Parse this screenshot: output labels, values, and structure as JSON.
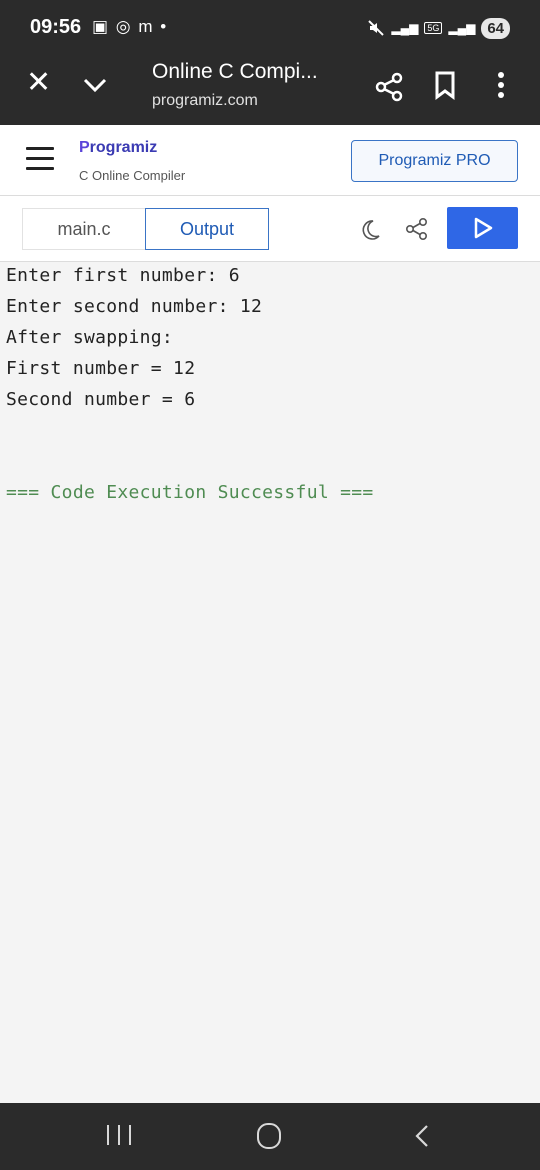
{
  "status": {
    "time": "09:56",
    "app_icons": [
      "▣",
      "◎",
      "m",
      "•"
    ],
    "network": "5G",
    "battery": "64"
  },
  "chrome": {
    "title": "Online C Compi...",
    "url": "programiz.com"
  },
  "site": {
    "logo_text": "rogramiz",
    "logo_p": "P",
    "subtitle": "C Online Compiler",
    "pro_button": "Programiz PRO"
  },
  "toolbar": {
    "tab_main": "main.c",
    "tab_output": "Output"
  },
  "output": {
    "lines": [
      "Enter first number: 6",
      "Enter second number: 12",
      "After swapping:",
      "First number = 12",
      "Second number = 6"
    ],
    "success": "=== Code Execution Successful ==="
  },
  "colors": {
    "accent": "#2f67e6",
    "success": "#4f8c52",
    "chrome_bg": "#2b2b2b"
  }
}
